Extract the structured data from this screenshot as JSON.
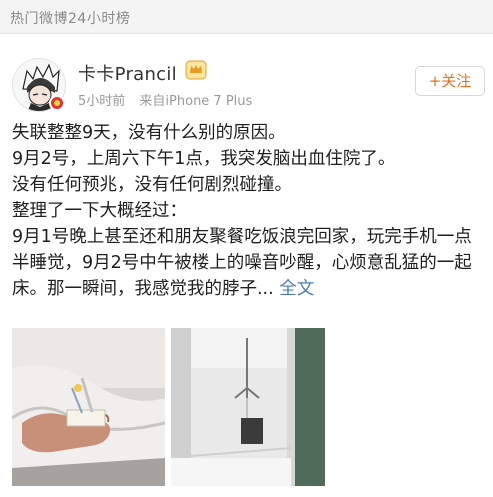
{
  "header": {
    "title": "热门微博24小时榜"
  },
  "post": {
    "author": "卡卡Prancil",
    "time": "5小时前",
    "source": "来自iPhone 7 Plus",
    "follow_label": "+关注",
    "paragraphs": [
      "失联整整9天，没有什么别的原因。",
      "9月2号，上周六下午1点，我突发脑出血住院了。",
      "没有任何预兆，没有任何剧烈碰撞。",
      "整理了一下大概经过：",
      "9月1号晚上甚至还和朋友聚餐吃饭浪完回家，玩完手机一点半睡觉，9月2号中午被楼上的噪音吵醒，心烦意乱猛的一起床。那一瞬间，我感觉我的脖子..."
    ],
    "read_more": "全文"
  },
  "icons": {
    "avatar": "anime-avatar",
    "verified": "verified-icon",
    "vip": "vip-crown-icon"
  },
  "colors": {
    "accent": "#e8711b",
    "link": "#4a7db9",
    "badge": "#e3342f"
  }
}
